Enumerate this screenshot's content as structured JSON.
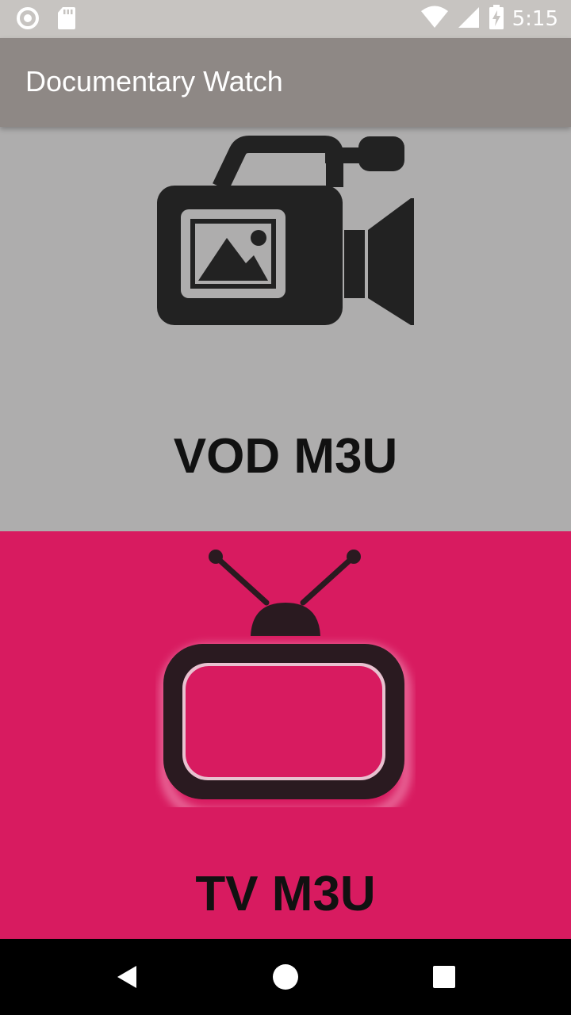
{
  "status_bar": {
    "time": "5:15",
    "icons": [
      "circle-notification-icon",
      "sd-card-icon",
      "wifi-icon",
      "cell-signal-icon",
      "battery-charging-icon"
    ]
  },
  "app_bar": {
    "title": "Documentary Watch",
    "color": "#8e8885"
  },
  "panels": {
    "vod": {
      "label": "VOD M3U",
      "icon": "video-camera-icon",
      "color": "#aeadad"
    },
    "tv": {
      "label": "TV M3U",
      "icon": "television-icon",
      "color": "#d81b60"
    }
  },
  "nav_bar": {
    "buttons": [
      "back-icon",
      "home-icon",
      "recents-icon"
    ]
  }
}
